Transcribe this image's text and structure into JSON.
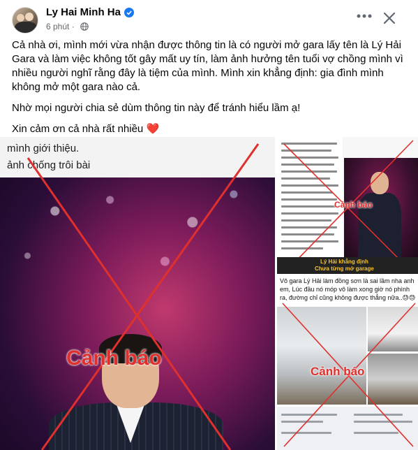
{
  "header": {
    "author": "Ly Hai Minh Ha",
    "time": "6 phút",
    "separator": "·"
  },
  "post": {
    "paragraphs": [
      "Cả nhà ơi, mình mới vừa nhận được thông tin là có người mở gara lấy tên là Lý Hải Gara và làm việc không tốt gây mất uy tín, làm ảnh hưởng tên tuổi vợ chồng mình vì nhiều người nghĩ rằng đây là tiệm của mình. Mình xin khẳng định: gia đình mình không mở một gara nào cả.",
      "Nhờ mọi người chia sẻ dùm thông tin này để tránh hiểu lầm ạ!",
      "Xin cảm ơn cả nhà rất nhiều"
    ],
    "heart": "❤️"
  },
  "photos": {
    "main_banner_line1": "mình giới thiệu.",
    "main_banner_line2": "ảnh chống trôi bài",
    "main_stamp": "Cảnh báo",
    "top_right_stamp": "Cảnh báo",
    "top_right_caption_line1": "Lý Hải khẳng định",
    "top_right_caption_line2": "Chưa từng mở garage",
    "bottom_right_text": "Vô gara Lý Hải làm đồng sơn là sai lầm nha anh em, Lúc đầu nó móp vô làm xong giờ nó phình ra, đường chỉ cũng không được thẳng nữa..😓😓",
    "bottom_right_stamp": "Cảnh báo"
  },
  "colors": {
    "verified": "#1877f2",
    "stamp": "#e0302e",
    "meta_text": "#65676b"
  },
  "icons": {
    "verified": "verified-badge-icon",
    "globe": "globe-icon",
    "more": "more-options-icon",
    "close": "close-icon"
  }
}
